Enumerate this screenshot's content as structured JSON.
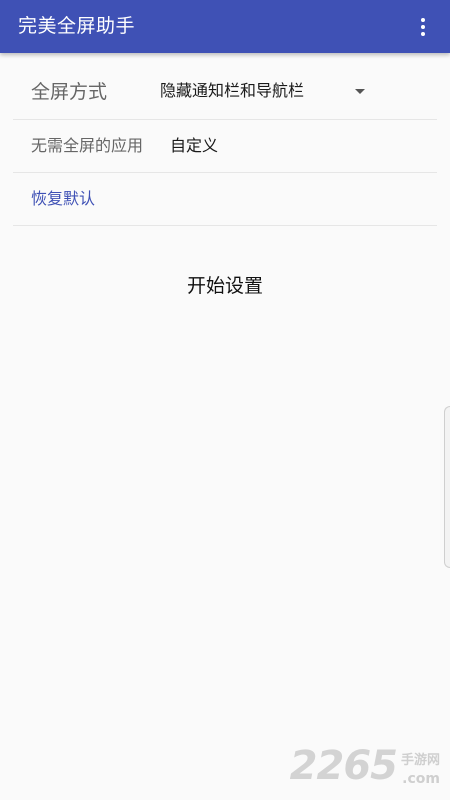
{
  "appbar": {
    "title": "完美全屏助手",
    "overflow_icon": "more-vert-icon"
  },
  "settings": {
    "fullscreen_mode": {
      "label": "全屏方式",
      "selected": "隐藏通知栏和导航栏"
    },
    "exempt_apps": {
      "label": "无需全屏的应用",
      "value": "自定义"
    },
    "restore_default": {
      "label": "恢复默认"
    }
  },
  "start_button": {
    "label": "开始设置"
  },
  "watermark": {
    "number": "2265",
    "text": "手游网",
    "domain": ".com"
  },
  "colors": {
    "primary": "#3f51b5",
    "background": "#fafafa",
    "divider": "#e6e6e6"
  }
}
